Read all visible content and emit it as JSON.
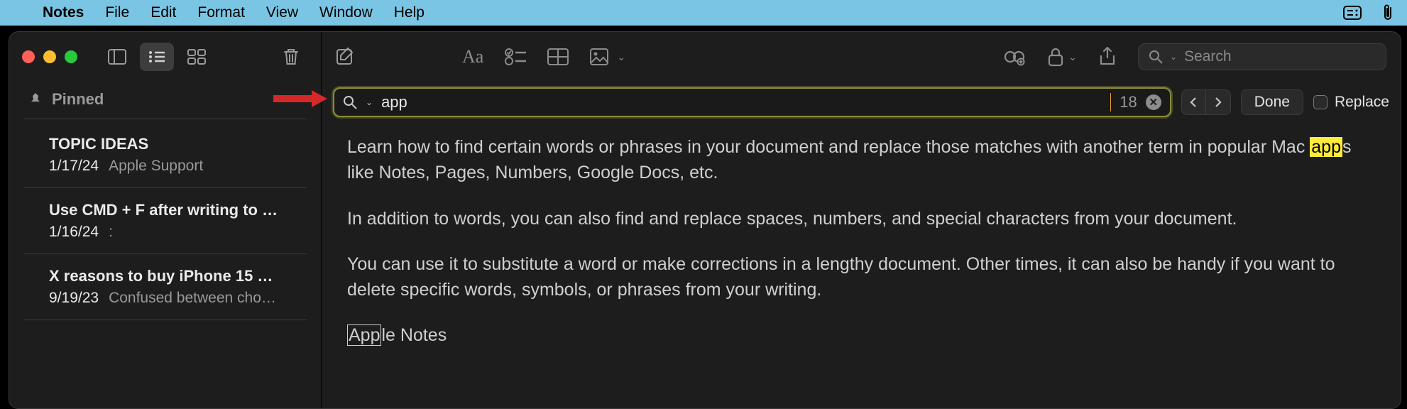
{
  "menubar": {
    "app": "Notes",
    "items": [
      "File",
      "Edit",
      "Format",
      "View",
      "Window",
      "Help"
    ]
  },
  "sidebar": {
    "pinned_label": "Pinned",
    "notes": [
      {
        "title": "TOPIC IDEAS",
        "date": "1/17/24",
        "preview": "Apple Support"
      },
      {
        "title": "Use CMD + F after writing to c…",
        "date": "1/16/24",
        "preview": ":"
      },
      {
        "title": "X reasons to buy iPhone 15 Pr…",
        "date": "9/19/23",
        "preview": "Confused between choosi…"
      }
    ]
  },
  "editor_toolbar": {
    "search_placeholder": "Search"
  },
  "findbar": {
    "query": "app",
    "match_count": "18",
    "done_label": "Done",
    "replace_label": "Replace"
  },
  "note_body": {
    "p1_a": "Learn how to find certain words or phrases in your document and replace those matches with another term in popular Mac ",
    "p1_hl": "app",
    "p1_b": "s like Notes, Pages, Numbers, Google Docs, etc.",
    "p2": "In addition to words, you can also find and replace spaces, numbers, and special characters from your document.",
    "p3": "You can use it to substitute a word or make corrections in a lengthy document. Other times, it can also be handy if you want to delete specific words, symbols, or phrases from your writing.",
    "p4_hl": "App",
    "p4_b": "le Notes"
  }
}
